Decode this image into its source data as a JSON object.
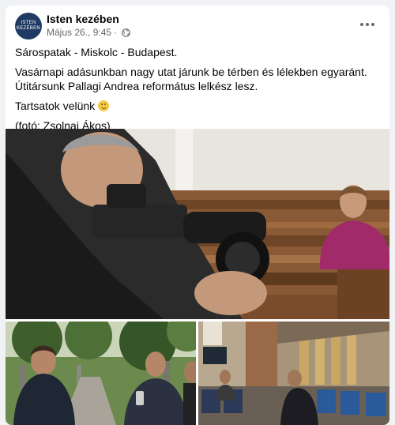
{
  "post": {
    "page_name": "Isten kezében",
    "avatar_text": [
      "ISTEN",
      "KEZÉBEN"
    ],
    "date": "Május 26., 9:45",
    "separator": "·",
    "paragraphs": [
      "Sárospatak - Miskolc - Budapest.",
      "Vasárnapi adásunkban nagy utat járunk be térben és lélekben egyaránt. Útitársunk Pallagi Andrea református lelkész lesz.",
      "Tartsatok velünk",
      "(fotó: Zsolnai Ákos)"
    ],
    "icons": {
      "privacy": "globe-icon",
      "menu": "more-options-icon",
      "emoji": "smiling-face-emoji"
    }
  },
  "photos": [
    {
      "subject": "Cameraman filming a woman in magenta sweater seated in a church pew"
    },
    {
      "subject": "Three people talking on a cobblestone path in a cemetery"
    },
    {
      "subject": "Film crew inside a church with blue chairs"
    }
  ],
  "colors": {
    "name": "#050505",
    "meta": "#65676b",
    "background": "#f0f2f5",
    "card": "#ffffff",
    "avatar": "#1f3b63"
  }
}
